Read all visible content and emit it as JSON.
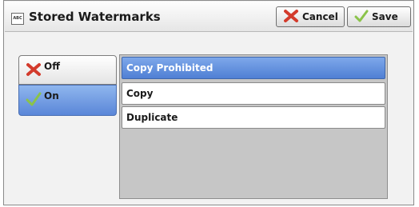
{
  "header": {
    "icon_text": "ABC",
    "title": "Stored Watermarks",
    "cancel_label": "Cancel",
    "save_label": "Save"
  },
  "toggle": {
    "off_label": "Off",
    "on_label": "On",
    "selected": "On"
  },
  "list": {
    "items": [
      "Copy Prohibited",
      "Copy",
      "Duplicate"
    ],
    "selected_index": 0
  },
  "icons": {
    "cancel": "x-icon",
    "save": "checkmark-icon"
  },
  "colors": {
    "selection": "#5a86d8",
    "cancel_x": "#d33b2c",
    "check": "#8bc34a"
  }
}
